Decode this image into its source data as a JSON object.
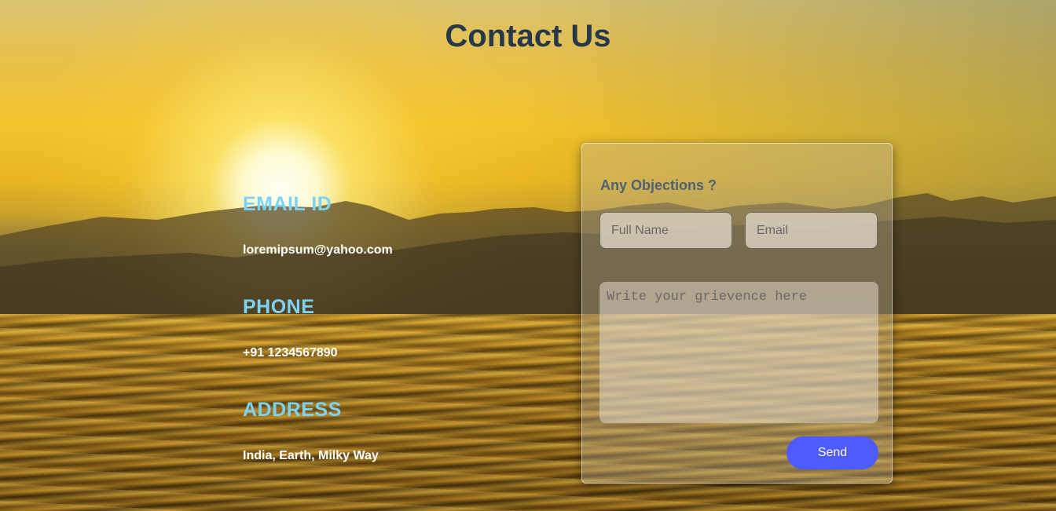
{
  "page": {
    "title": "Contact Us"
  },
  "contact_info": [
    {
      "heading": "EMAIL ID",
      "value": "loremipsum@yahoo.com"
    },
    {
      "heading": "PHONE",
      "value": "+91 1234567890"
    },
    {
      "heading": "ADDRESS",
      "value": "India, Earth, Milky Way"
    }
  ],
  "form": {
    "title": "Any Objections ?",
    "name_placeholder": "Full Name",
    "email_placeholder": "Email",
    "message_placeholder": "Write your grievence here",
    "send_label": "Send"
  },
  "colors": {
    "title": "#27384a",
    "heading_accent": "#7dd3f4",
    "button": "#4d5bff"
  }
}
